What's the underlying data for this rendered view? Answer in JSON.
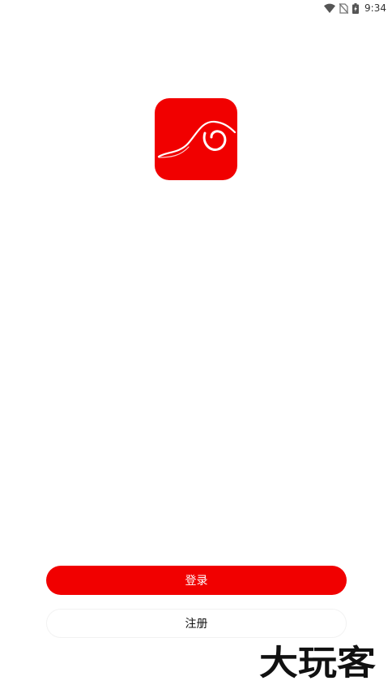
{
  "status_bar": {
    "time": "9:34",
    "icons": [
      "wifi-icon",
      "no-sim-icon",
      "battery-charging-icon"
    ]
  },
  "app": {
    "logo_icon": "app-logo-icon",
    "brand_color": "#f10000"
  },
  "actions": {
    "login_label": "登录",
    "register_label": "注册"
  },
  "watermark": {
    "text": "大玩客"
  }
}
